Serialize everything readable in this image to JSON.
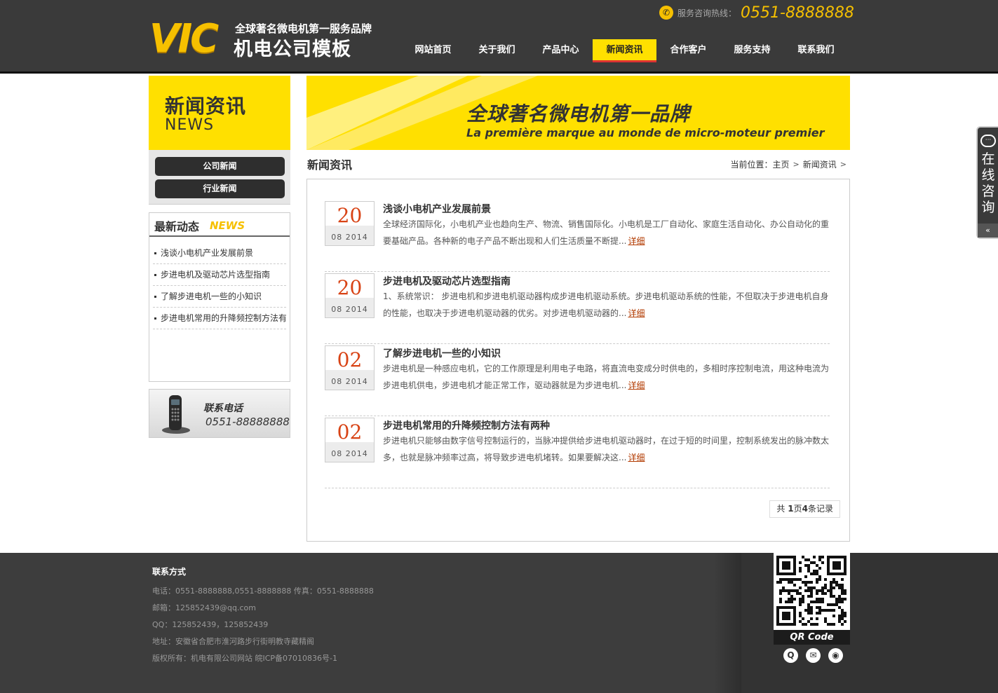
{
  "header": {
    "logo_mark": "VIC",
    "logo_slogan": "全球著名微电机第一服务品牌",
    "logo_brand": "机电公司模板",
    "hotline_label": "服务咨询热线：",
    "hotline_number": "0551-8888888",
    "nav": [
      {
        "label": "网站首页",
        "active": false
      },
      {
        "label": "关于我们",
        "active": false
      },
      {
        "label": "产品中心",
        "active": false
      },
      {
        "label": "新闻资讯",
        "active": true
      },
      {
        "label": "合作客户",
        "active": false
      },
      {
        "label": "服务支持",
        "active": false
      },
      {
        "label": "联系我们",
        "active": false
      }
    ]
  },
  "sidebar": {
    "banner_cn": "新闻资讯",
    "banner_en": "NEWS",
    "categories": [
      "公司新闻",
      "行业新闻"
    ],
    "latest_title_cn": "最新动态",
    "latest_title_en": "NEWS",
    "latest": [
      "浅谈小电机产业发展前景",
      "步进电机及驱动芯片选型指南",
      "了解步进电机一些的小知识",
      "步进电机常用的升降频控制方法有"
    ],
    "contact_title": "联系电话",
    "contact_number": "0551-88888888"
  },
  "banner": {
    "headline": "全球著名微电机第一品牌",
    "subline": "La première marque au monde de micro-moteur premier"
  },
  "main": {
    "section_title": "新闻资讯",
    "breadcrumb_label": "当前位置：",
    "breadcrumb_home": "主页",
    "breadcrumb_current": "新闻资讯",
    "more_label": "详细",
    "news": [
      {
        "day": "20",
        "ym": "08 2014",
        "title": "浅谈小电机产业发展前景",
        "summary": "全球经济国际化，小电机产业也趋向生产、物流、销售国际化。小电机是工厂自动化、家庭生活自动化、办公自动化的重要基础产品。各种新的电子产品不断出现和人们生活质量不断提..."
      },
      {
        "day": "20",
        "ym": "08 2014",
        "title": "步进电机及驱动芯片选型指南",
        "summary": "1、系统常识： 步进电机和步进电机驱动器构成步进电机驱动系统。步进电机驱动系统的性能，不但取决于步进电机自身的性能，也取决于步进电机驱动器的优劣。对步进电机驱动器的..."
      },
      {
        "day": "02",
        "ym": "08 2014",
        "title": "了解步进电机一些的小知识",
        "summary": "步进电机是一种感应电机，它的工作原理是利用电子电路，将直流电变成分时供电的，多相时序控制电流，用这种电流为步进电机供电，步进电机才能正常工作，驱动器就是为步进电机..."
      },
      {
        "day": "02",
        "ym": "08 2014",
        "title": "步进电机常用的升降频控制方法有两种",
        "summary": "步进电机只能够由数字信号控制运行的，当脉冲提供给步进电机驱动器时，在过于短的时间里，控制系统发出的脉冲数太多，也就是脉冲频率过高，将导致步进电机堵转。如果要解决这..."
      }
    ],
    "pager": {
      "prefix": "共 ",
      "pages": "1",
      "mid": "页",
      "records": "4",
      "suffix": "条记录"
    }
  },
  "footer": {
    "title": "联系方式",
    "lines": [
      "电话：0551-8888888,0551-8888888 传真：0551-8888888",
      "邮箱：125852439@qq.com",
      "QQ：125852439，125852439",
      "地址：安徽省合肥市淮河路步行街明教寺藏精阁",
      "版权所有：机电有限公司网站 皖ICP备07010836号-1"
    ],
    "qr_label": "QR Code",
    "social_icons": [
      "qq-icon",
      "mail-icon",
      "weibo-icon"
    ]
  },
  "float_consult": {
    "text": "在线咨询",
    "arrow": "«"
  },
  "colors": {
    "header_bg": "#3a3a3a",
    "accent_yellow": "#ffe000",
    "date_red": "#d84315",
    "footer_bg": "#3d3d3d"
  }
}
